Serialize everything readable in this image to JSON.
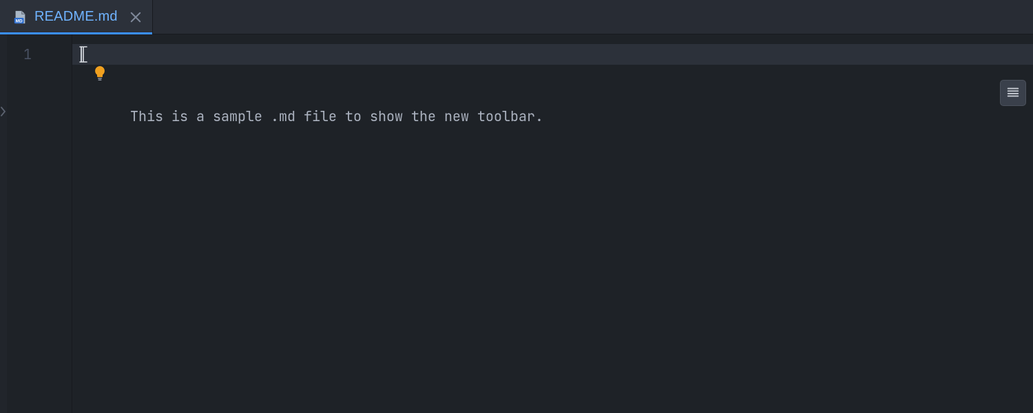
{
  "tab": {
    "filename": "README.md",
    "icon_badge_text": "MD",
    "close_tooltip": "Close"
  },
  "editor": {
    "line_number": "1",
    "content": "This is a sample .md file to show the new toolbar."
  },
  "icons": {
    "lightbulb": "lightbulb-icon",
    "paragraph_toolbar": "paragraph-icon"
  },
  "colors": {
    "tab_active_border": "#3a8fff",
    "tab_text": "#6fb3ff",
    "bulb": "#f0a01f",
    "bg": "#1e2227"
  }
}
